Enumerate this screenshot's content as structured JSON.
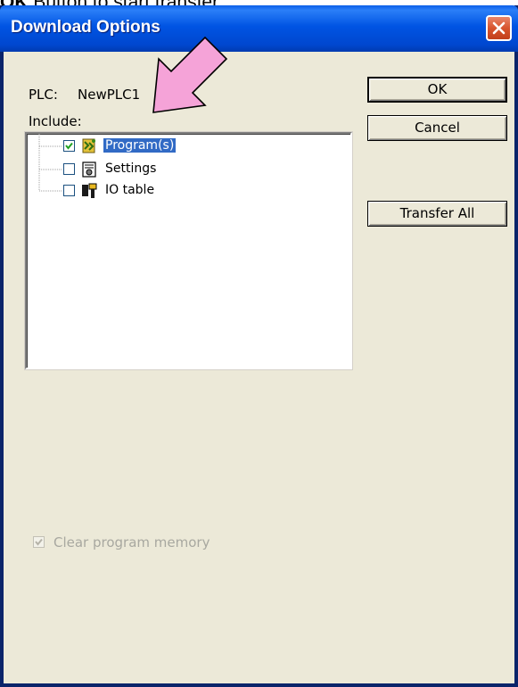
{
  "caption": {
    "bold_prefix": "OK",
    "text": " Button to start transfer."
  },
  "dialog": {
    "title": "Download Options",
    "plc_label": "PLC:",
    "plc_value": "NewPLC1",
    "include_label": "Include:",
    "tree_items": [
      {
        "label": "Program(s)",
        "checked": true,
        "selected": true,
        "icon": "program-icon"
      },
      {
        "label": "Settings",
        "checked": false,
        "selected": false,
        "icon": "settings-icon"
      },
      {
        "label": "IO table",
        "checked": false,
        "selected": false,
        "icon": "io-table-icon"
      }
    ],
    "buttons": {
      "ok": "OK",
      "cancel": "Cancel",
      "transfer_all": "Transfer All"
    },
    "clear_program_memory": {
      "label": "Clear program memory",
      "checked": true,
      "disabled": true
    }
  },
  "annotation": {
    "arrow_color": "#f5a3d8",
    "arrow_outline": "#000000"
  },
  "colors": {
    "titlebar": "#0054e3",
    "dialog_bg": "#ece9d8",
    "selection": "#316ac5"
  }
}
